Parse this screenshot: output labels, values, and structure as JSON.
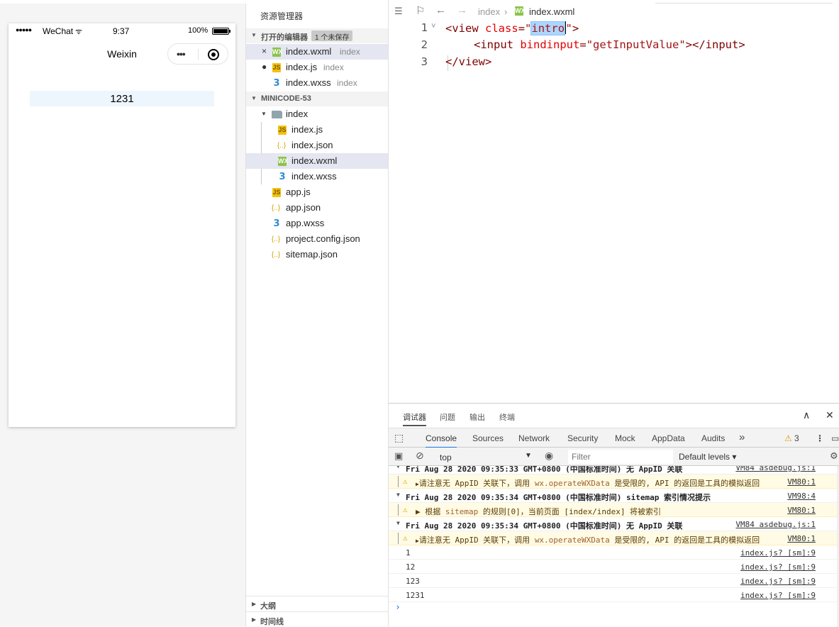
{
  "simulator": {
    "status": {
      "signal": "●●●●●",
      "carrier": "WeChat",
      "wifi": "ᯤ",
      "time": "9:37",
      "battery": "100%"
    },
    "nav_title": "Weixin",
    "capsule_dots": "•••",
    "input_value": "1231"
  },
  "explorer": {
    "title": "资源管理器",
    "open_editors": {
      "label": "打开的编辑器",
      "badge": "1 个未保存"
    },
    "open_files": [
      {
        "mark": "×",
        "icon": "WX",
        "name": "index.wxml",
        "dir": "index"
      },
      {
        "mark": "●",
        "icon": "JS",
        "name": "index.js",
        "dir": "index"
      },
      {
        "mark": "",
        "icon": "3",
        "name": "index.wxss",
        "dir": "index"
      }
    ],
    "project": {
      "label": "MINICODE-53"
    },
    "tree": [
      {
        "name": "index",
        "icon": "folder"
      },
      {
        "name": "index.js",
        "icon": "JS"
      },
      {
        "name": "index.json",
        "icon": "{..}"
      },
      {
        "name": "index.wxml",
        "icon": "WX"
      },
      {
        "name": "index.wxss",
        "icon": "3"
      },
      {
        "name": "app.js",
        "icon": "JS"
      },
      {
        "name": "app.json",
        "icon": "{..}"
      },
      {
        "name": "app.wxss",
        "icon": "3"
      },
      {
        "name": "project.config.json",
        "icon": "{..}"
      },
      {
        "name": "sitemap.json",
        "icon": "{..}"
      }
    ],
    "outline": "大纲",
    "timeline": "时间线"
  },
  "editor": {
    "breadcrumb": {
      "folder": "index",
      "sep": "›",
      "file": "index.wxml"
    },
    "lines": [
      {
        "no": "1",
        "fold": "˅"
      },
      {
        "no": "2",
        "fold": ""
      },
      {
        "no": "3",
        "fold": ""
      }
    ],
    "code": {
      "l1_open": "<view",
      "l1_attr": "class",
      "l1_eq": "=",
      "l1_q1": "\"",
      "l1_val": "intro",
      "l1_q2": "\"",
      "l1_close": ">",
      "l2_open": "<input",
      "l2_attr": "bindinput",
      "l2_eq": "=",
      "l2_val": "\"getInputValue\"",
      "l2_close": "></input>",
      "l3": "</view>"
    }
  },
  "devtools": {
    "top_tabs": [
      "调试器",
      "问题",
      "输出",
      "终端"
    ],
    "tabs": [
      "Console",
      "Sources",
      "Network",
      "Security",
      "Mock",
      "AppData",
      "Audits"
    ],
    "more": "»",
    "warning_count": "3",
    "context": "top",
    "filter_placeholder": "Filter",
    "levels": "Default levels ▾",
    "console": [
      {
        "kind": "grp",
        "text": "Fri Aug 28 2020 09:35:33 GMT+0800 (中国标准时间) 无 AppID 关联",
        "src": "VM84 asdebug.js:1"
      },
      {
        "kind": "warn",
        "pre": "请注意无 AppID 关联下，调用 ",
        "code": "wx.operateWXData",
        "post": " 是受限的, API 的返回是工具的模拟返回",
        "src": "VM80:1"
      },
      {
        "kind": "grp",
        "text": "Fri Aug 28 2020 09:35:34 GMT+0800 (中国标准时间) sitemap 索引情况提示",
        "src": "VM98:4"
      },
      {
        "kind": "warn",
        "pre": "▶ 根据 ",
        "code": "sitemap",
        "post": " 的规则[0]，当前页面 [index/index] 将被索引",
        "src": "VM80:1"
      },
      {
        "kind": "grp",
        "text": "Fri Aug 28 2020 09:35:34 GMT+0800 (中国标准时间) 无 AppID 关联",
        "src": "VM84 asdebug.js:1"
      },
      {
        "kind": "warn",
        "pre": "请注意无 AppID 关联下，调用 ",
        "code": "wx.operateWXData",
        "post": " 是受限的, API 的返回是工具的模拟返回",
        "src": "VM80:1"
      },
      {
        "kind": "log",
        "text": "1",
        "src": "index.js? [sm]:9"
      },
      {
        "kind": "log",
        "text": "12",
        "src": "index.js? [sm]:9"
      },
      {
        "kind": "log",
        "text": "123",
        "src": "index.js? [sm]:9"
      },
      {
        "kind": "log",
        "text": "1231",
        "src": "index.js? [sm]:9"
      }
    ],
    "prompt": "›"
  },
  "colors": {
    "accent": "#1a73e8",
    "warn_bg": "#fffbe5",
    "wxml_icon": "#8bc34a",
    "js_icon": "#f4c20d"
  }
}
